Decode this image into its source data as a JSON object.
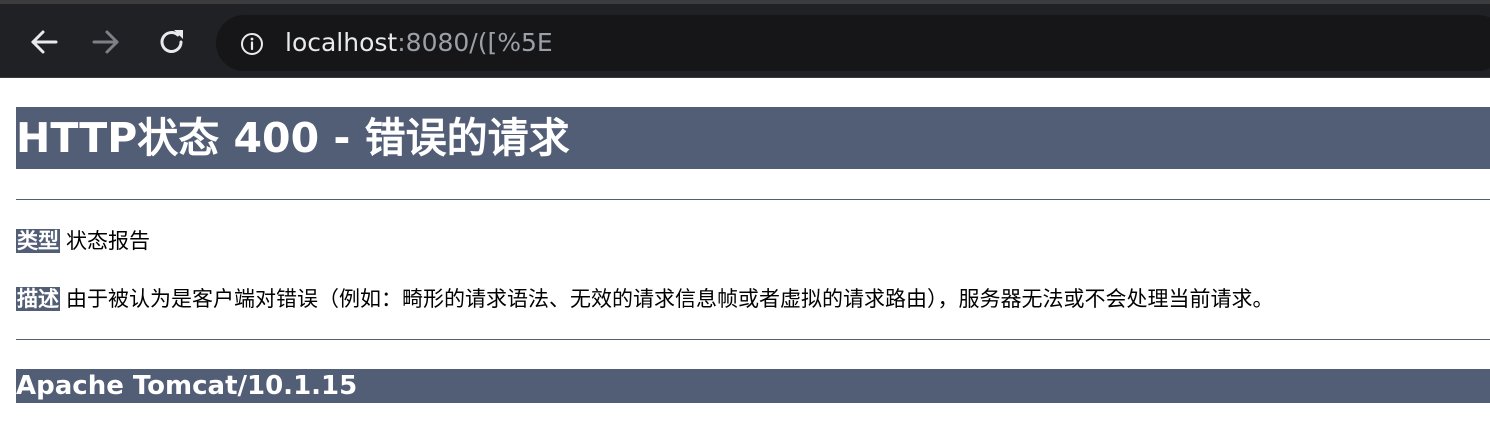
{
  "browser": {
    "address_host": "localhost",
    "address_rest": ":8080/([%5E",
    "back_icon": "arrow-left",
    "forward_icon": "arrow-right",
    "reload_icon": "reload",
    "info_icon": "info-circle"
  },
  "page": {
    "title": "HTTP状态 400 - 错误的请求",
    "type_label": "类型",
    "type_value": "状态报告",
    "description_label": "描述",
    "description_value": "由于被认为是客户端对错误（例如：畸形的请求语法、无效的请求信息帧或者虚拟的请求路由），服务器无法或不会处理当前请求。",
    "footer": "Apache Tomcat/10.1.15"
  },
  "colors": {
    "header_bg": "#525d76",
    "toolbar_bg": "#202124",
    "omnibox_bg": "#161618"
  }
}
